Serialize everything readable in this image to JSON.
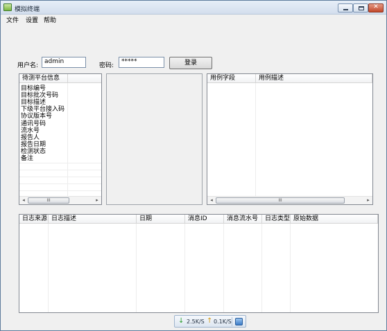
{
  "window": {
    "title": "模拟终端"
  },
  "menu": [
    "文件",
    "设置",
    "帮助"
  ],
  "login": {
    "username_label": "用户名:",
    "username_value": "admin",
    "password_label": "密码:",
    "password_value": "*****",
    "login_button": "登录"
  },
  "platform_list": {
    "header": "待测平台信息",
    "items": [
      "目标编号",
      "目标批次号码",
      "目标描述",
      "下级平台接入码",
      "协议版本号",
      "通讯号码",
      "流水号",
      "报告人",
      "报告日期",
      "检测状态",
      "备注"
    ]
  },
  "testcase_table": {
    "columns": [
      "用例字段",
      "用例描述"
    ]
  },
  "log_table": {
    "columns": [
      "日志来源",
      "日志描述",
      "日期",
      "消息ID",
      "消息流水号",
      "日志类型",
      "原始数据"
    ]
  },
  "status": {
    "download_rate": "2.5K/S",
    "upload_rate": "0.1K/S"
  },
  "scroll_thumb_label": "III",
  "icons": {
    "left_arrow": "◂",
    "right_arrow": "▸",
    "minimize": "minimize-icon",
    "maximize": "maximize-icon",
    "close": "✕"
  },
  "colors": {
    "title_bg": "#d3deed",
    "close_button": "#c2472a",
    "down_arrow": "#2a9d2a",
    "up_arrow": "#d49b16"
  }
}
